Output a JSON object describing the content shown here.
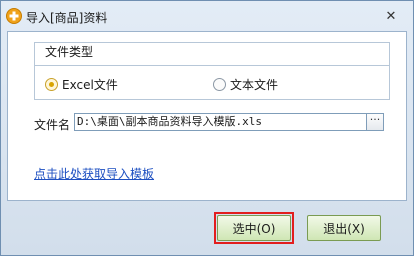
{
  "window": {
    "title": "导入[商品]资料",
    "close_glyph": "✕"
  },
  "file_type_group": {
    "title": "文件类型",
    "options": [
      {
        "label": "Excel文件",
        "selected": true
      },
      {
        "label": "文本文件",
        "selected": false
      }
    ]
  },
  "file_name": {
    "label": "文件名",
    "value": "D:\\桌面\\副本商品资料导入模版.xls",
    "browse_label": "···"
  },
  "template_link": {
    "text": "点击此处获取导入模板"
  },
  "buttons": {
    "select_label": "选中(O)",
    "exit_label": "退出(X)"
  },
  "colors": {
    "highlight_outline": "#e21e1e",
    "button_green": "#cfe6b4",
    "link_blue": "#1d4fc1"
  },
  "icons": {
    "app": "orange-plus-app-icon",
    "close": "close-icon",
    "browse": "ellipsis-icon"
  }
}
